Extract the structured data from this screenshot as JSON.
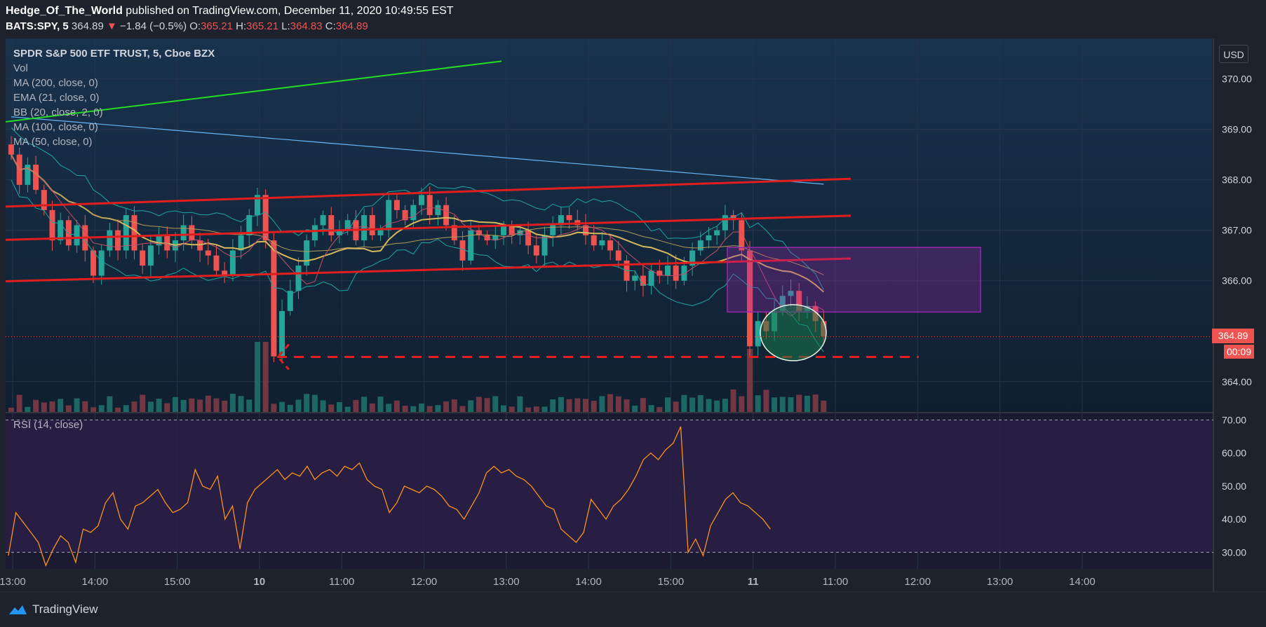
{
  "header": {
    "author": "Hedge_Of_The_World",
    "published_text": "published on TradingView.com, December 11, 2020 10:49:55 EST",
    "symbol": "BATS:SPY, 5",
    "last": "364.89",
    "change_arrow": "▼",
    "change": "−1.84 (−0.5%)",
    "o_label": "O:",
    "o_value": "365.21",
    "h_label": "H:",
    "h_value": "365.21",
    "l_label": "L:",
    "l_value": "364.83",
    "c_label": "C:",
    "c_value": "364.89"
  },
  "legend": {
    "title": "SPDR S&P 500 ETF TRUST, 5, Cboe BZX",
    "items": [
      "Vol",
      "MA (200, close, 0)",
      "EMA (21, close, 0)",
      "BB (20, close, 2, 0)",
      "MA (100, close, 0)",
      "MA (50, close, 0)"
    ]
  },
  "rsi_label": "RSI (14, close)",
  "currency": "USD",
  "price_tag": "364.89",
  "timer_tag": "00:09",
  "brand": "TradingView",
  "colors": {
    "up": "#26a69a",
    "down": "#ef5350",
    "rsi": "#f7931e",
    "ma200": "#64b5f6",
    "ma50": "#d4b85a",
    "bb": "#1aa6a6",
    "ema": "#c2506b",
    "trend_green": "#22dd22",
    "channel_red": "#e01e1e",
    "box": "#9c27b0"
  },
  "chart_data": [
    {
      "type": "candlestick",
      "title": "SPDR S&P 500 ETF TRUST, 5, Cboe BZX",
      "y_ticks": [
        "370.00",
        "369.00",
        "368.00",
        "367.00",
        "366.00",
        "364.00"
      ],
      "ylim": [
        363.4,
        370.8
      ],
      "x_ticks": [
        "13:00",
        "14:00",
        "15:00",
        "10",
        "11:00",
        "12:00",
        "13:00",
        "14:00",
        "15:00",
        "11",
        "11:00",
        "12:00",
        "13:00",
        "14:00"
      ],
      "last_price": 364.89,
      "closes": [
        368.5,
        367.9,
        368.3,
        367.8,
        367.4,
        366.8,
        367.2,
        366.7,
        367.1,
        366.6,
        366.1,
        366.6,
        367.0,
        366.6,
        367.3,
        366.6,
        366.3,
        366.7,
        366.9,
        366.6,
        366.8,
        367.1,
        366.8,
        366.6,
        366.5,
        366.2,
        366.1,
        366.6,
        366.9,
        367.3,
        367.7,
        366.8,
        364.5,
        365.4,
        365.8,
        366.3,
        366.8,
        367.1,
        367.3,
        366.9,
        367.0,
        367.2,
        366.8,
        367.3,
        366.9,
        367.0,
        367.6,
        367.4,
        367.2,
        367.5,
        367.7,
        367.3,
        367.5,
        367.1,
        366.8,
        366.4,
        367.0,
        366.9,
        366.8,
        366.9,
        367.1,
        366.9,
        367.0,
        366.7,
        366.5,
        366.9,
        367.1,
        367.3,
        367.2,
        367.1,
        366.9,
        366.7,
        366.8,
        366.6,
        366.4,
        366.0,
        366.1,
        365.9,
        366.2,
        366.1,
        366.3,
        366.0,
        366.3,
        366.6,
        366.8,
        366.9,
        367.0,
        367.3,
        367.2,
        366.6,
        364.7,
        365.2,
        365.0,
        365.4,
        365.7,
        365.8,
        365.4,
        365.5,
        365.2,
        364.9
      ],
      "volume_note": "volume bars shown beneath candles",
      "annotations": [
        "ascending red channel lines",
        "green rising trend line",
        "purple rectangle zone",
        "circle highlight",
        "dashed red support line with arrow"
      ]
    },
    {
      "type": "line",
      "title": "RSI (14, close)",
      "y_ticks": [
        "70.00",
        "60.00",
        "50.00",
        "40.00",
        "30.00"
      ],
      "ylim": [
        25,
        72
      ],
      "levels": [
        70,
        30
      ],
      "values": [
        29,
        42,
        39,
        36,
        33,
        26,
        31,
        35,
        33,
        27,
        37,
        36,
        38,
        45,
        48,
        40,
        37,
        44,
        45,
        47,
        49,
        45,
        42,
        43,
        45,
        55,
        50,
        49,
        53,
        40,
        44,
        31,
        45,
        49,
        51,
        53,
        55,
        52,
        54,
        53,
        56,
        52,
        54,
        55,
        53,
        56,
        55,
        57,
        52,
        50,
        49,
        42,
        45,
        50,
        49,
        48,
        50,
        49,
        47,
        44,
        43,
        40,
        44,
        48,
        54,
        56,
        54,
        55,
        53,
        52,
        50,
        47,
        44,
        43,
        37,
        35,
        33,
        36,
        46,
        43,
        40,
        44,
        46,
        49,
        53,
        58,
        60,
        58,
        61,
        63,
        68,
        30,
        34,
        29,
        38,
        42,
        46,
        48,
        45,
        44,
        42,
        40,
        37
      ]
    }
  ]
}
